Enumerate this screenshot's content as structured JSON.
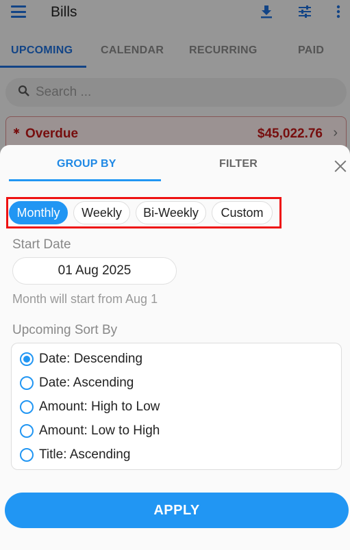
{
  "app": {
    "title": "Bills",
    "tabs": [
      "UPCOMING",
      "CALENDAR",
      "RECURRING",
      "PAID"
    ],
    "search_placeholder": "Search ...",
    "overdue": {
      "label": "Overdue",
      "amount": "$45,022.76"
    }
  },
  "sheet": {
    "tabs": {
      "group_by": "GROUP BY",
      "filter": "FILTER"
    },
    "group_options": [
      {
        "label": "Monthly",
        "selected": true
      },
      {
        "label": "Weekly",
        "selected": false
      },
      {
        "label": "Bi-Weekly",
        "selected": false
      },
      {
        "label": "Custom",
        "selected": false
      }
    ],
    "start_date_label": "Start Date",
    "start_date_value": "01 Aug 2025",
    "start_hint": "Month will start from Aug 1",
    "sort_label": "Upcoming Sort By",
    "sort_options": [
      {
        "label": "Date: Descending",
        "selected": true
      },
      {
        "label": "Date: Ascending",
        "selected": false
      },
      {
        "label": "Amount: High to Low",
        "selected": false
      },
      {
        "label": "Amount: Low to High",
        "selected": false
      },
      {
        "label": "Title: Ascending",
        "selected": false
      }
    ],
    "apply_label": "APPLY"
  },
  "colors": {
    "accent": "#2196f3",
    "overdue": "#c01818",
    "highlight": "#e11111"
  }
}
